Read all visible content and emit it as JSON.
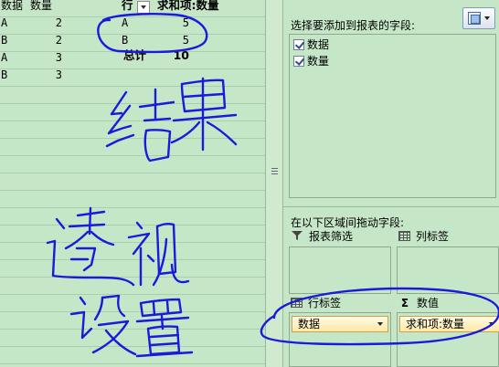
{
  "sheet": {
    "source": {
      "headers": [
        "数据",
        "数量"
      ],
      "rows": [
        [
          "A",
          "2"
        ],
        [
          "B",
          "2"
        ],
        [
          "A",
          "3"
        ],
        [
          "B",
          "3"
        ]
      ]
    },
    "pivot": {
      "row_header": "行",
      "value_header": "求和项:数量",
      "rows": [
        [
          "A",
          "5"
        ],
        [
          "B",
          "5"
        ]
      ],
      "total_label": "总计",
      "total_value": "10"
    }
  },
  "pane": {
    "choose_fields_label": "选择要添加到报表的字段:",
    "fields": [
      {
        "label": "数据",
        "checked": true
      },
      {
        "label": "数量",
        "checked": true
      }
    ],
    "drag_label": "在以下区域间拖动字段:",
    "areas": {
      "report_filter": {
        "label": "报表筛选",
        "icon": "filter-icon"
      },
      "column_labels": {
        "label": "列标签",
        "icon": "column-labels-icon"
      },
      "row_labels": {
        "label": "行标签",
        "icon": "row-labels-icon",
        "field": "数据"
      },
      "values": {
        "label": "数值",
        "icon": "sigma-icon",
        "field": "求和项:数量"
      }
    }
  },
  "annotations": {
    "color": "#1a1adc"
  }
}
